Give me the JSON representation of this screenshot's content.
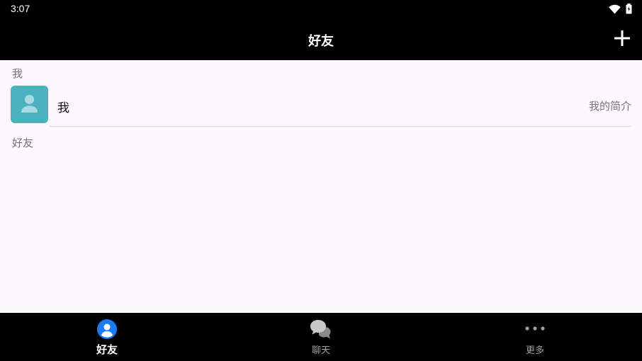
{
  "status_bar": {
    "time": "3:07",
    "icons": [
      "wifi-icon",
      "battery-icon"
    ]
  },
  "header": {
    "title": "好友",
    "add_icon": "plus-icon"
  },
  "sections": {
    "me_header": "我",
    "friends_header": "好友"
  },
  "me_row": {
    "name": "我",
    "bio": "我的简介",
    "avatar_icon": "person-icon",
    "avatar_color": "#4ab2be"
  },
  "bottom_nav": {
    "items": [
      {
        "label": "好友",
        "icon": "friends-icon",
        "active": true
      },
      {
        "label": "聊天",
        "icon": "chat-bubbles-icon",
        "active": false
      },
      {
        "label": "更多",
        "icon": "more-dots-icon",
        "active": false
      }
    ],
    "accent_color": "#1a7cf5"
  }
}
